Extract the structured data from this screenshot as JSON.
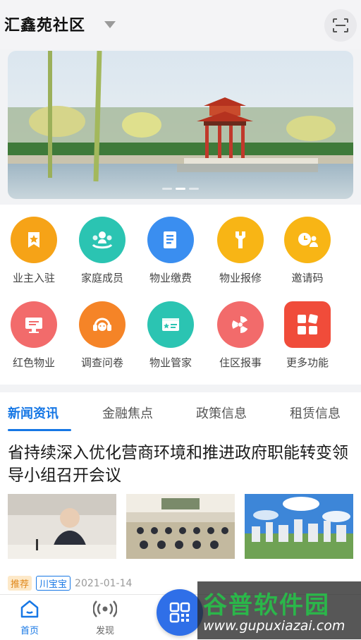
{
  "header": {
    "community_name": "汇鑫苑社区"
  },
  "features": [
    {
      "label": "业主入驻",
      "color": "#f6a317",
      "icon": "owner-checkin-icon"
    },
    {
      "label": "家庭成员",
      "color": "#2bc4b2",
      "icon": "family-member-icon"
    },
    {
      "label": "物业缴费",
      "color": "#3a8ef0",
      "icon": "property-payment-icon"
    },
    {
      "label": "物业报修",
      "color": "#f8b515",
      "icon": "repair-wrench-icon"
    },
    {
      "label": "邀请码",
      "color": "#f8b515",
      "icon": "invite-code-icon"
    },
    {
      "label": "红色物业",
      "color": "#f26b6b",
      "icon": "red-property-icon"
    },
    {
      "label": "调查问卷",
      "color": "#f58427",
      "icon": "survey-headset-icon"
    },
    {
      "label": "物业管家",
      "color": "#2bc4b2",
      "icon": "butler-card-icon"
    },
    {
      "label": "住区报事",
      "color": "#f26b6b",
      "icon": "report-fan-icon"
    },
    {
      "label": "更多功能",
      "color": "#f04c3a",
      "icon": "more-grid-icon"
    }
  ],
  "tabs": [
    {
      "label": "新闻资讯",
      "active": true
    },
    {
      "label": "金融焦点",
      "active": false
    },
    {
      "label": "政策信息",
      "active": false
    },
    {
      "label": "租赁信息",
      "active": false
    }
  ],
  "article": {
    "title": "省持续深入优化营商环境和推进政府职能转变领导小组召开会议",
    "tag_recommend": "推荐",
    "tag_source": "川宝宝",
    "date": "2021-01-14"
  },
  "bottom_nav": [
    {
      "label": "首页",
      "icon": "home-icon",
      "active": true
    },
    {
      "label": "发现",
      "icon": "discover-signal-icon",
      "active": false
    }
  ],
  "watermark": {
    "title": "谷普软件园",
    "url": "www.gupuxiazai.com"
  },
  "colors": {
    "accent": "#1677e5",
    "fab": "#2f6fe8"
  }
}
